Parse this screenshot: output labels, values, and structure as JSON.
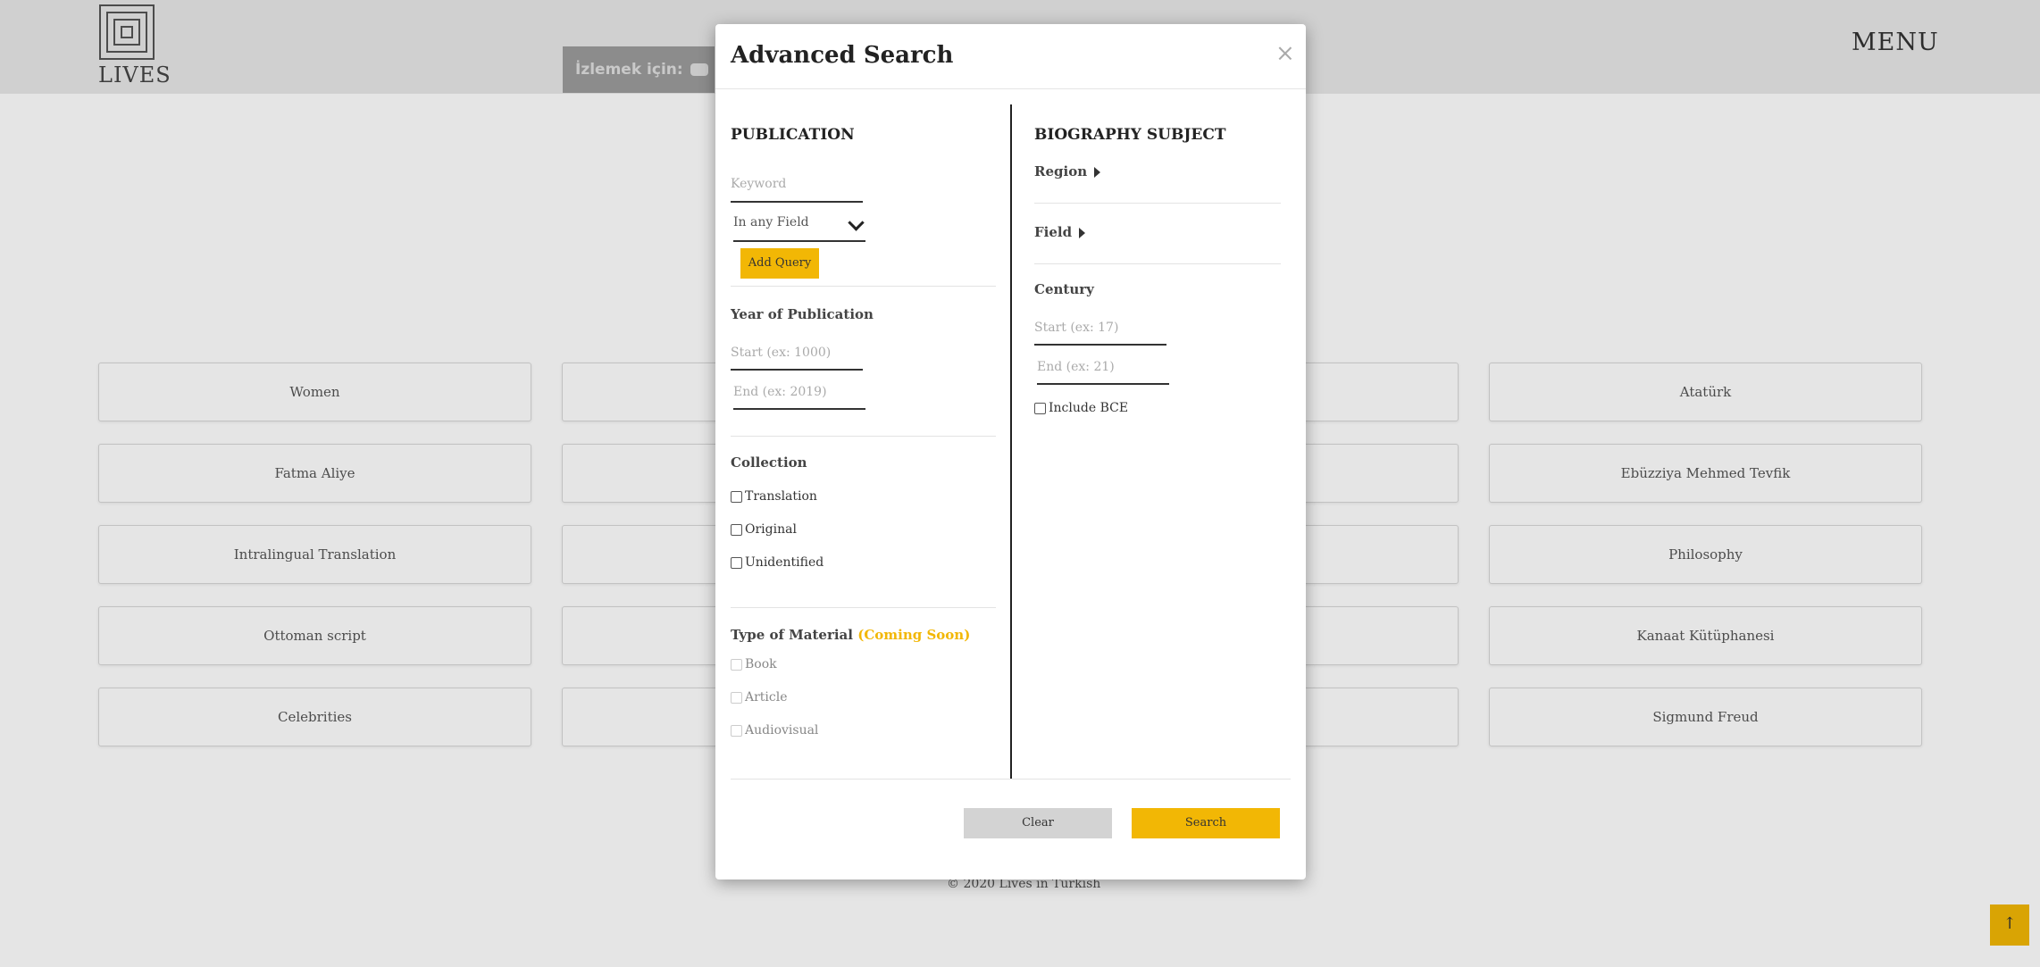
{
  "header": {
    "logo_text": "LIVES",
    "menu_label": "MENU",
    "video_hint": "İzlemek için:"
  },
  "tags": {
    "col1": [
      "Women",
      "Fatma Aliye",
      "Intralingual Translation",
      "Ottoman script",
      "Celebrities"
    ],
    "col4": [
      "Atatürk",
      "Ebüzziya Mehmed Tevfik",
      "Philosophy",
      "Kanaat Kütüphanesi",
      "Sigmund Freud"
    ]
  },
  "footer": {
    "copyright": "© 2020 Lives in Turkish",
    "scroll_top": "↑"
  },
  "modal": {
    "title": "Advanced Search",
    "close": "×",
    "publication": {
      "title": "PUBLICATION",
      "keyword_placeholder": "Keyword",
      "field_select": "In any Field",
      "add_query": "Add Query",
      "year_title": "Year of Publication",
      "year_start_placeholder": "Start (ex: 1000)",
      "year_end_placeholder": "End (ex: 2019)",
      "collection_title": "Collection",
      "collection_options": [
        "Translation",
        "Original",
        "Unidentified"
      ],
      "material_title": "Type of Material",
      "material_note": "(Coming Soon)",
      "material_options": [
        "Book",
        "Article",
        "Audiovisual"
      ]
    },
    "biography": {
      "title": "BIOGRAPHY SUBJECT",
      "region_label": "Region",
      "field_label": "Field",
      "century_title": "Century",
      "century_start_placeholder": "Start (ex: 17)",
      "century_end_placeholder": "End (ex: 21)",
      "include_bce": "Include BCE"
    },
    "actions": {
      "clear": "Clear",
      "search": "Search"
    }
  },
  "colors": {
    "accent": "#f2b705",
    "clear_button": "#d3d3d3",
    "header_bg": "#e8e8e8"
  }
}
